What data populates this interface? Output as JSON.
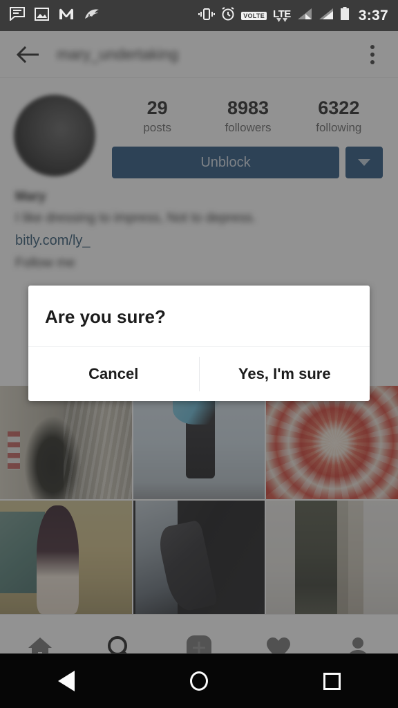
{
  "status_bar": {
    "time": "3:37",
    "volte_label": "VOLTE",
    "lte_label": "LTE",
    "left_icons": [
      "message-icon",
      "photo-icon",
      "m-monogram-icon",
      "shell-icon"
    ],
    "right_icons": [
      "vibrate-icon",
      "alarm-icon",
      "volte-badge",
      "lte-icon",
      "signal-bars-1-icon",
      "signal-bars-2-icon",
      "battery-icon"
    ],
    "background_color": "#3b3b3b"
  },
  "app_bar": {
    "back_icon": "back-arrow-icon",
    "username": "mary_undertaking",
    "overflow_icon": "overflow-menu-icon"
  },
  "profile": {
    "avatar": "profile-avatar",
    "stats": [
      {
        "value": "29",
        "label": "posts"
      },
      {
        "value": "8983",
        "label": "followers"
      },
      {
        "value": "6322",
        "label": "following"
      }
    ],
    "unblock_label": "Unblock",
    "dropdown_icon": "chevron-down-icon",
    "bio_name": "Mary",
    "bio_text": "I like dressing to impress, Not to depress.",
    "bio_link": "bitly.com/ly_",
    "bio_extra": "Follow me",
    "button_color": "#1b4a77",
    "link_color": "#274e6c"
  },
  "grid": {
    "photos": [
      {
        "name": "photo-christmas-tree-hall",
        "alt": "Christmas tree inside a glass hall with flag"
      },
      {
        "name": "photo-person-blue-wall",
        "alt": "Person in black outfit against pale blue wall"
      },
      {
        "name": "photo-red-white-flower",
        "alt": "Red and white dahlia flower close-up"
      },
      {
        "name": "photo-woman-beach",
        "alt": "Woman with long dark hair on a beach at sunset"
      },
      {
        "name": "photo-dark-boots",
        "alt": "Dark toned photo of legs and boots"
      },
      {
        "name": "photo-olive-outfit",
        "alt": "Person in olive outfit on pale background"
      }
    ]
  },
  "bottom_nav": {
    "items": [
      {
        "name": "nav-home",
        "icon": "home-icon",
        "active": false
      },
      {
        "name": "nav-search",
        "icon": "search-icon",
        "active": true
      },
      {
        "name": "nav-add",
        "icon": "add-post-icon",
        "active": false
      },
      {
        "name": "nav-activity",
        "icon": "heart-icon",
        "active": false
      },
      {
        "name": "nav-profile",
        "icon": "person-icon",
        "active": false
      }
    ]
  },
  "dialog": {
    "title": "Are you sure?",
    "cancel_label": "Cancel",
    "confirm_label": "Yes, I'm sure"
  },
  "android_nav": {
    "back": "nav-back-icon",
    "home": "nav-home-circle-icon",
    "recents": "nav-recents-square-icon"
  }
}
